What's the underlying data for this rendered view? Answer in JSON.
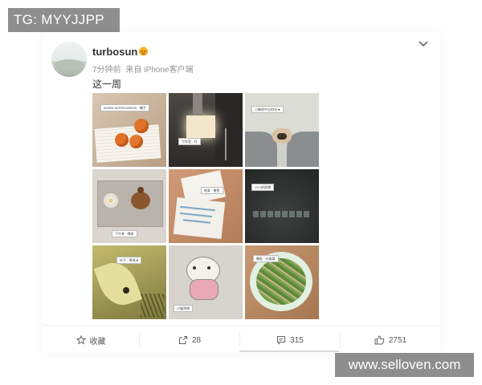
{
  "watermarks": {
    "top": "TG: MYYJJPP",
    "bottom": "www.selloven.com"
  },
  "post": {
    "username": "turbosun",
    "time": "7分钟前",
    "source_prefix": "来自",
    "source": "iPhone客户端",
    "text": "这一周",
    "icons": {
      "vip": "vip-crown-icon",
      "more": "chevron-down-icon"
    }
  },
  "photos": [
    {
      "name": "oranges-on-paper",
      "caption": "WORK IN PROGRESS · 橘子"
    },
    {
      "name": "studio-light",
      "caption": "工作室 · 灯"
    },
    {
      "name": "dog-between-legs",
      "caption": "小狗的午后时光 ♥"
    },
    {
      "name": "tea-set-tray",
      "caption": "下午茶 · 喝茶"
    },
    {
      "name": "handwritten-notes",
      "caption": "纸条 · 便签"
    },
    {
      "name": "dark-wall-text",
      "caption": "小小的愿望"
    },
    {
      "name": "leaf-in-grass",
      "caption": "叶子 · 草地 ♥"
    },
    {
      "name": "cat-drawing",
      "caption": "小猫涂鸦"
    },
    {
      "name": "vegetable-plate",
      "caption": "晚饭 · 炒青菜"
    }
  ],
  "actions": {
    "favorite": {
      "label": "收藏",
      "icon": "star-icon"
    },
    "repost": {
      "count": "28",
      "icon": "repost-icon"
    },
    "comment": {
      "count": "315",
      "icon": "comment-icon"
    },
    "like": {
      "count": "2751",
      "icon": "thumbs-up-icon"
    }
  },
  "colors": {
    "watermark_bg": "#8e8e8e",
    "text_primary": "#333333",
    "text_meta": "#939393",
    "vip_gold": "#f5a623"
  }
}
